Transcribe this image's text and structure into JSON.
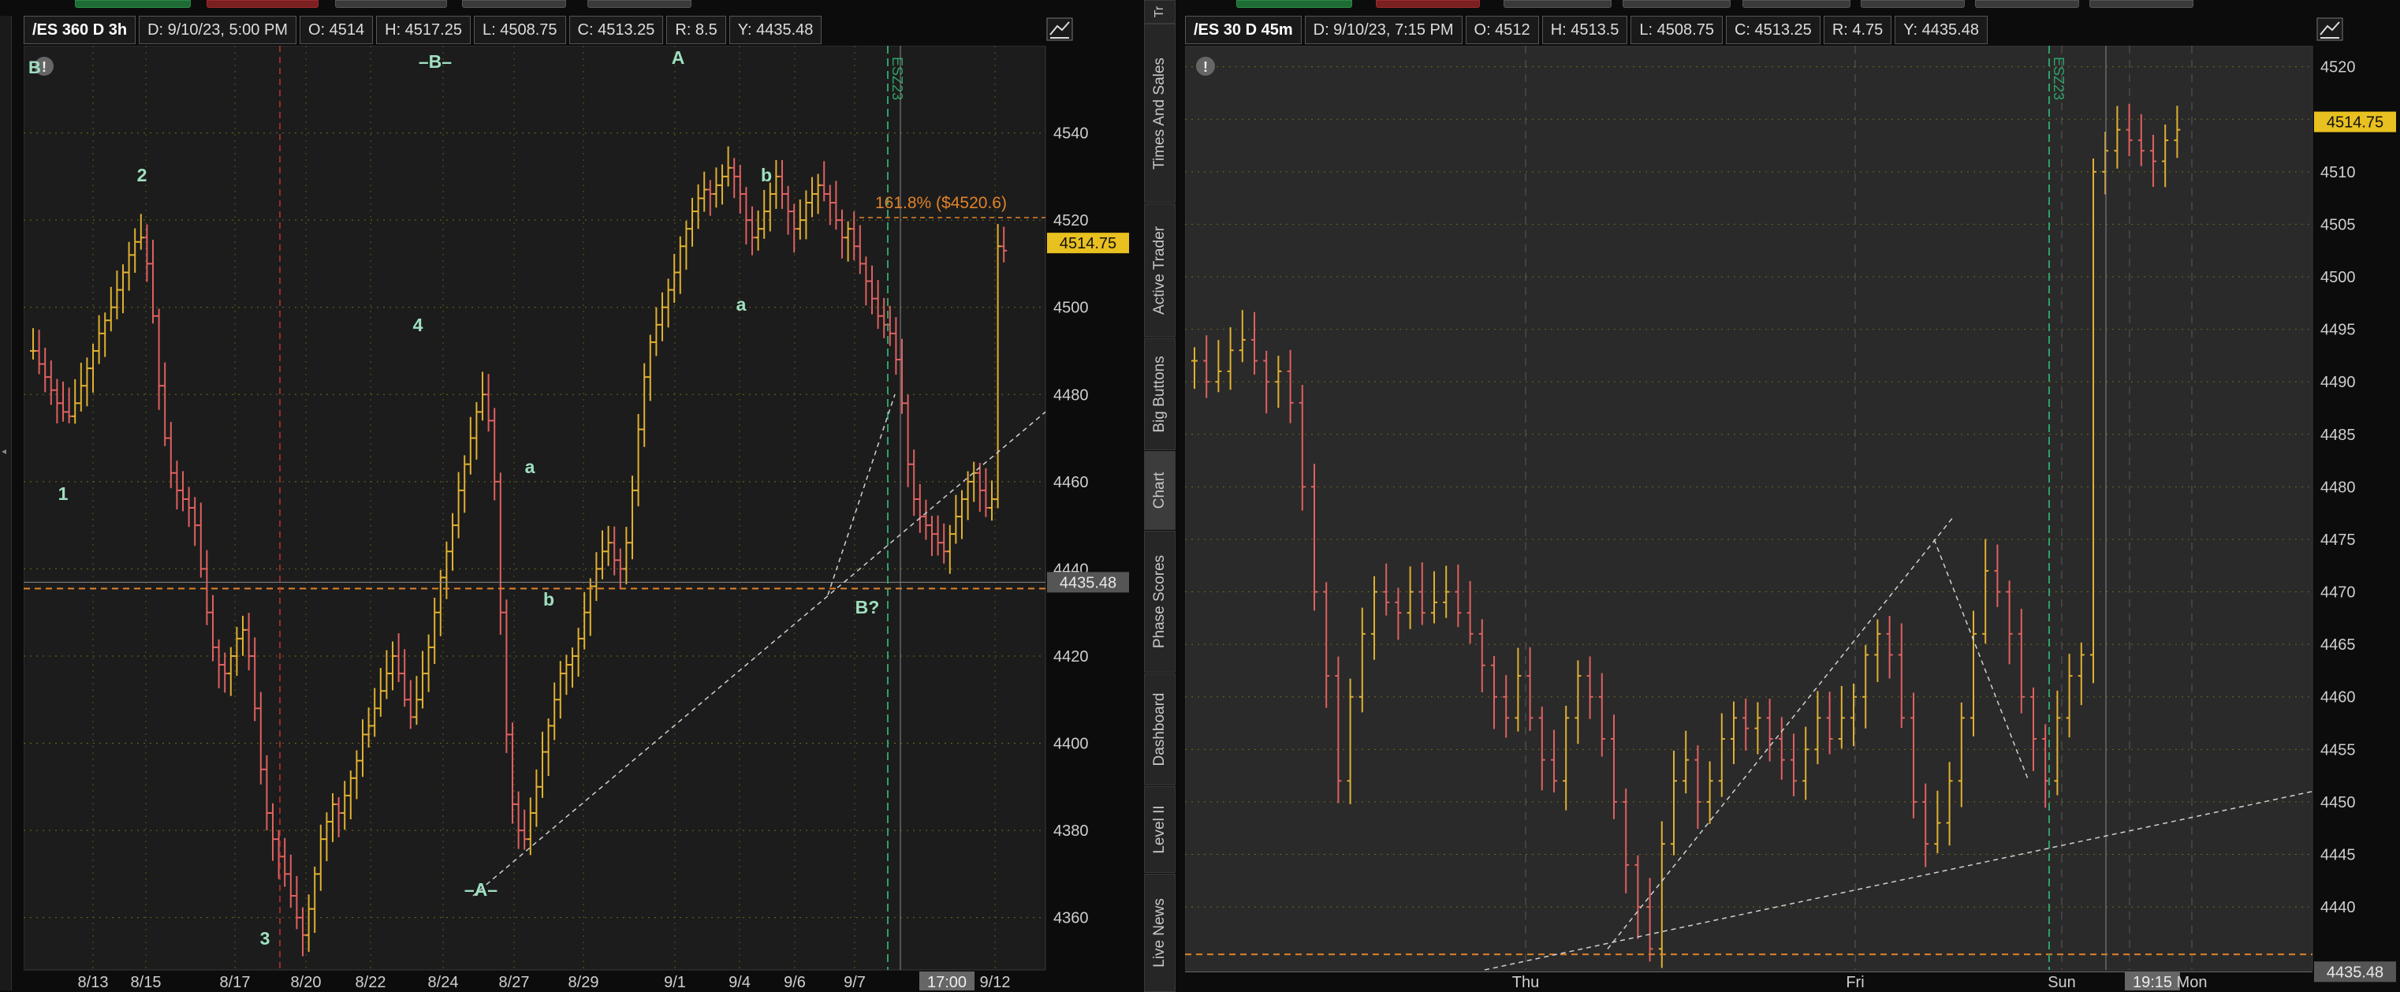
{
  "left": {
    "header": {
      "symbol": "/ES 360 D 3h",
      "date": "D: 9/10/23, 5:00 PM",
      "open": "O: 4514",
      "high": "H: 4517.25",
      "low": "L: 4508.75",
      "close": "C: 4513.25",
      "range": "R: 8.5",
      "y": "Y: 4435.48"
    },
    "chart_data": {
      "type": "bar",
      "ylim": [
        4348,
        4560
      ],
      "y_ticks": [
        "4360",
        "4380",
        "4400",
        "4420",
        "4440",
        "4460",
        "4480",
        "4500",
        "4520",
        "4540"
      ],
      "x_ticks": [
        "8/13",
        "8/15",
        "8/17",
        "8/20",
        "8/22",
        "8/24",
        "8/27",
        "8/29",
        "9/1",
        "9/4",
        "9/6",
        "9/7",
        "17:00",
        "9/12"
      ],
      "price_label": "4514.75",
      "hline_label": "4435.48",
      "hline_value": 4435.48,
      "fib_label": "161.8%  ($4520.6)",
      "fib_value": 4520.6,
      "wave_labels": [
        "1",
        "2",
        "3",
        "4",
        "a",
        "b",
        "–A–",
        "–B–",
        "A",
        "b",
        "a",
        "B?"
      ],
      "vline_label": "ESZ23",
      "alert_glyph": "!",
      "corner_mark": "B",
      "closes": [
        4490,
        4487,
        4484,
        4481,
        4478,
        4476,
        4475,
        4478,
        4482,
        4486,
        4490,
        4494,
        4497,
        4500,
        4504,
        4508,
        4512,
        4515,
        4516,
        4510,
        4498,
        4482,
        4470,
        4462,
        4458,
        4456,
        4454,
        4450,
        4440,
        4430,
        4422,
        4418,
        4416,
        4420,
        4424,
        4426,
        4420,
        4408,
        4394,
        4384,
        4378,
        4374,
        4370,
        4365,
        4360,
        4356,
        4362,
        4370,
        4378,
        4382,
        4386,
        4384,
        4388,
        4392,
        4396,
        4402,
        4404,
        4408,
        4412,
        4416,
        4420,
        4416,
        4410,
        4406,
        4410,
        4416,
        4422,
        4430,
        4438,
        4444,
        4450,
        4458,
        4464,
        4470,
        4476,
        4480,
        4474,
        4460,
        4430,
        4402,
        4386,
        4380,
        4378,
        4384,
        4390,
        4398,
        4404,
        4410,
        4416,
        4418,
        4420,
        4424,
        4430,
        4436,
        4440,
        4444,
        4446,
        4442,
        4440,
        4446,
        4458,
        4472,
        4484,
        4492,
        4496,
        4500,
        4504,
        4508,
        4514,
        4518,
        4522,
        4525,
        4527,
        4526,
        4528,
        4530,
        4532,
        4530,
        4526,
        4520,
        4516,
        4518,
        4522,
        4526,
        4530,
        4526,
        4522,
        4518,
        4520,
        4524,
        4526,
        4528,
        4526,
        4524,
        4520,
        4516,
        4518,
        4514,
        4510,
        4506,
        4502,
        4498,
        4496,
        4494,
        4488,
        4478,
        4464,
        4456,
        4452,
        4450,
        4448,
        4446,
        4444,
        4448,
        4452,
        4456,
        4460,
        4462,
        4458,
        4454,
        4456,
        4514,
        4513
      ]
    }
  },
  "right": {
    "header": {
      "symbol": "/ES 30 D 45m",
      "date": "D: 9/10/23, 7:15 PM",
      "open": "O: 4512",
      "high": "H: 4513.5",
      "low": "L: 4508.75",
      "close": "C: 4513.25",
      "range": "R: 4.75",
      "y": "Y: 4435.48"
    },
    "chart_data": {
      "type": "bar",
      "ylim": [
        4434,
        4522
      ],
      "y_ticks": [
        "4440",
        "4445",
        "4450",
        "4455",
        "4460",
        "4465",
        "4470",
        "4475",
        "4480",
        "4485",
        "4490",
        "4495",
        "4500",
        "4505",
        "4510",
        "4515",
        "4520"
      ],
      "x_ticks": [
        "Thu",
        "Fri",
        "Sun",
        "19:15",
        "Mon"
      ],
      "price_label": "4514.75",
      "hline_label": "4435.48",
      "hline_value": 4435.48,
      "vline_label": "ESZ23",
      "alert_glyph": "!",
      "closes": [
        4492,
        4490,
        4491,
        4493,
        4494,
        4492,
        4490,
        4491,
        4488,
        4480,
        4470,
        4462,
        4452,
        4460,
        4466,
        4470,
        4469,
        4468,
        4470,
        4468,
        4469,
        4470,
        4468,
        4466,
        4463,
        4460,
        4458,
        4462,
        4458,
        4454,
        4452,
        4458,
        4462,
        4460,
        4456,
        4450,
        4444,
        4440,
        4436,
        4446,
        4452,
        4454,
        4450,
        4452,
        4456,
        4458,
        4457,
        4458,
        4456,
        4454,
        4452,
        4455,
        4458,
        4456,
        4458,
        4460,
        4464,
        4466,
        4464,
        4458,
        4450,
        4446,
        4448,
        4452,
        4458,
        4466,
        4472,
        4470,
        4466,
        4460,
        4456,
        4452,
        4458,
        4462,
        4464,
        4510,
        4512,
        4514,
        4513,
        4512,
        4511,
        4513,
        4514
      ]
    }
  },
  "side_tabs": [
    "Times And Sales",
    "Active Trader",
    "Big Buttons",
    "Chart",
    "Phase Scores",
    "Dashboard",
    "Level II",
    "Live News"
  ]
}
